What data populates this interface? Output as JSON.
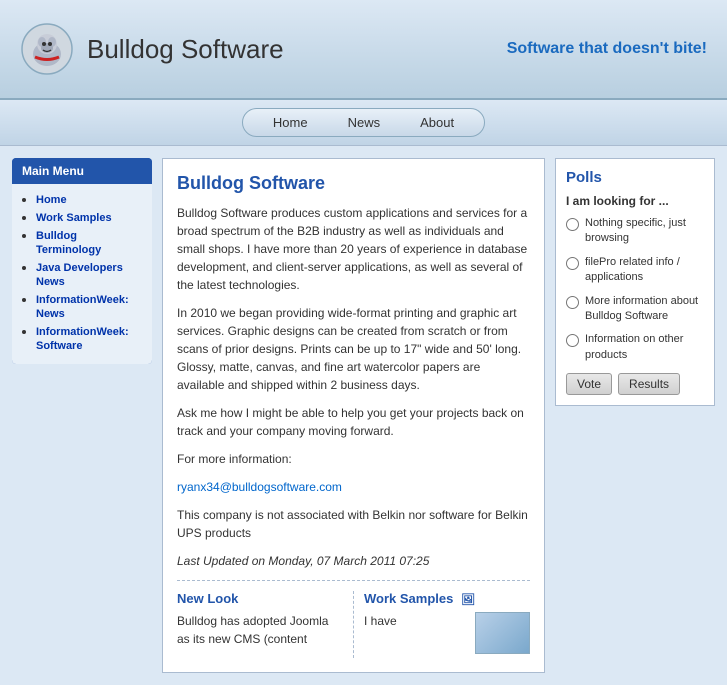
{
  "header": {
    "site_title": "Bulldog Software",
    "tagline": "Software that doesn't bite!"
  },
  "nav": {
    "items": [
      {
        "label": "Home",
        "id": "home"
      },
      {
        "label": "News",
        "id": "news"
      },
      {
        "label": "About",
        "id": "about"
      }
    ]
  },
  "sidebar": {
    "title": "Main Menu",
    "links": [
      {
        "label": "Home"
      },
      {
        "label": "Work Samples"
      },
      {
        "label": "Bulldog Terminology"
      },
      {
        "label": "Java Developers News"
      },
      {
        "label": "InformationWeek: News"
      },
      {
        "label": "InformationWeek: Software"
      }
    ]
  },
  "content": {
    "title": "Bulldog Software",
    "paragraph1": "Bulldog Software produces custom applications and services for a broad spectrum of the B2B industry as well as individuals and small shops. I have more than 20 years of experience in database development, and client-server applications, as well as several of the latest technologies.",
    "paragraph2": "In 2010 we began providing wide-format printing and graphic art services. Graphic designs can be created from scratch or from scans of prior designs. Prints can be up to 17\" wide and 50' long. Glossy, matte, canvas, and fine art watercolor papers are available and shipped within 2 business days.",
    "paragraph3": "Ask me how I might be able to help you get your projects back on track and your company moving forward.",
    "for_more": "For more information:",
    "email": "ryanx34@bulldogsoftware.com",
    "belkin_notice": "This company is not associated with Belkin nor software for Belkin UPS products",
    "last_updated": "Last Updated on Monday, 07 March 2011 07:25",
    "article1": {
      "title": "New Look",
      "text": "Bulldog has adopted Joomla as its new CMS (content"
    },
    "article2": {
      "title": "Work Samples",
      "text": "I have"
    }
  },
  "polls": {
    "title": "Polls",
    "subtitle": "I am looking for ...",
    "options": [
      {
        "id": "opt1",
        "label": "Nothing specific, just browsing"
      },
      {
        "id": "opt2",
        "label": "filePro related info / applications"
      },
      {
        "id": "opt3",
        "label": "More information about Bulldog Software"
      },
      {
        "id": "opt4",
        "label": "Information on other products"
      }
    ],
    "vote_btn": "Vote",
    "results_btn": "Results"
  }
}
